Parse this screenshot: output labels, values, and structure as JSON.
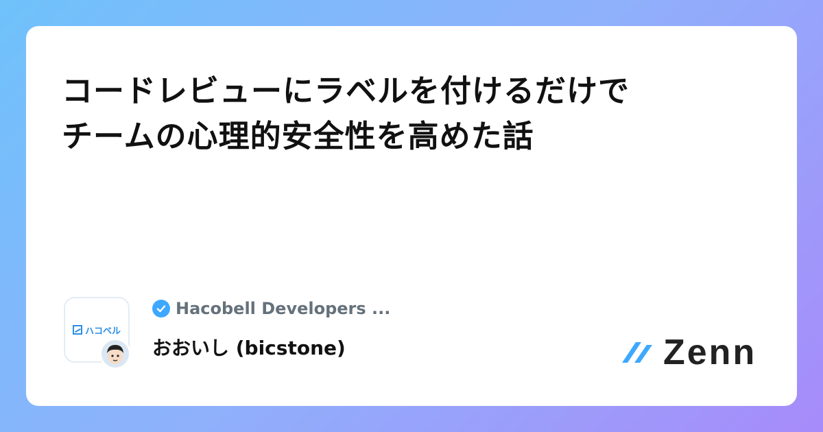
{
  "title_line1": "コードレビューにラベルを付けるだけで",
  "title_line2": "チームの心理的安全性を高めた話",
  "publication": {
    "name": "Hacobell Developers ...",
    "logo_text": "ハコベル",
    "verified_icon": "check-badge-icon"
  },
  "author": {
    "name": "おおいし (bicstone)"
  },
  "brand": {
    "name": "Zenn",
    "accent": "#3ea8ff"
  },
  "colors": {
    "title": "#111111",
    "publication": "#65717b",
    "background_start": "#6fc2fb",
    "background_end": "#a78bfa"
  }
}
